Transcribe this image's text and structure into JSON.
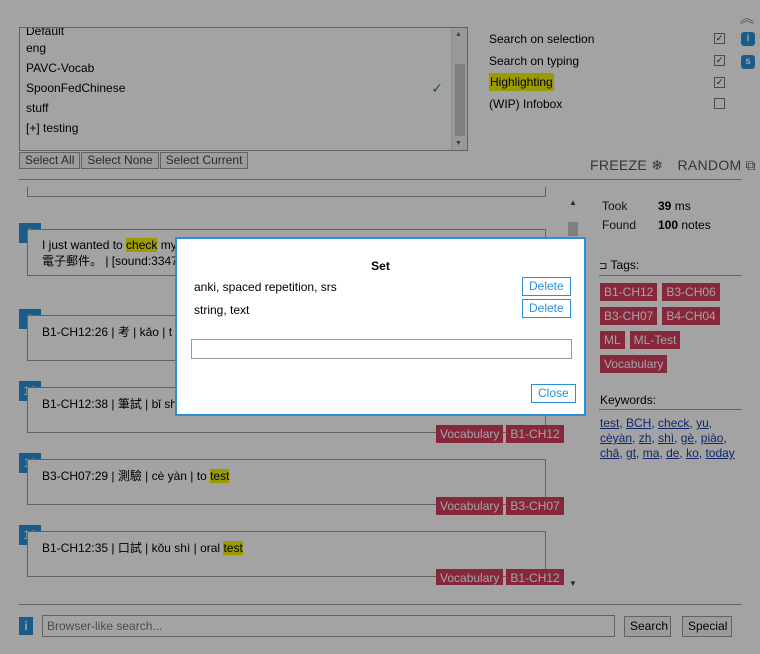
{
  "decks": {
    "items": [
      {
        "label": "Default",
        "checked": false
      },
      {
        "label": "eng",
        "checked": false
      },
      {
        "label": "PAVC-Vocab",
        "checked": false
      },
      {
        "label": "SpoonFedChinese",
        "checked": true
      },
      {
        "label": "stuff",
        "checked": false
      },
      {
        "label": "[+] testing",
        "checked": false
      }
    ],
    "check_mark": "✓",
    "buttons": [
      "Select All",
      "Select None",
      "Select Current"
    ]
  },
  "options": [
    {
      "label": "Search on selection",
      "checked": true,
      "highlighted": false
    },
    {
      "label": "Search on typing",
      "checked": true,
      "highlighted": false
    },
    {
      "label": "Highlighting",
      "checked": true,
      "highlighted": true
    },
    {
      "label": "(WIP) Infobox",
      "checked": false,
      "highlighted": false
    }
  ],
  "side_buttons": [
    "i",
    "s"
  ],
  "controls": {
    "freeze": "FREEZE ❄",
    "random": "RANDOM ⧉"
  },
  "results": [
    {
      "num": "8",
      "text_before": "I just wanted to ",
      "highlight": "check",
      "text_after": " my",
      "line2": "電子郵件。 | [sound:3347",
      "tags": []
    },
    {
      "num": "9",
      "text_before": "B1-CH12:26 | 考 | kǎo | t",
      "highlight": "",
      "text_after": "",
      "line2": "",
      "tags": []
    },
    {
      "num": "10",
      "text_before": "B1-CH12:38 | 筆試 | bǐ sh",
      "highlight": "",
      "text_after": "",
      "line2": "",
      "tags": [
        "Vocabulary",
        "B1-CH12"
      ]
    },
    {
      "num": "11",
      "text_before": "B3-CH07:29 | 測驗 | cè yàn | to ",
      "highlight": "test",
      "text_after": "",
      "line2": "",
      "tags": [
        "Vocabulary",
        "B3-CH07"
      ]
    },
    {
      "num": "12",
      "text_before": "B1-CH12:35 | 口試 | kǒu shì | oral ",
      "highlight": "test",
      "text_after": "",
      "line2": "",
      "tags": [
        "Vocabulary",
        "B1-CH12"
      ]
    }
  ],
  "stats": {
    "took_label": "Took",
    "took_value": "39",
    "took_unit": "ms",
    "found_label": "Found",
    "found_value": "100",
    "found_unit": "notes"
  },
  "tags_panel": {
    "title": "Tags:",
    "icon": "tag-icon",
    "tags": [
      "B1-CH12",
      "B3-CH06",
      "B3-CH07",
      "B4-CH04",
      "ML",
      "ML-Test",
      "Vocabulary"
    ]
  },
  "keywords_panel": {
    "title": "Keywords:",
    "keywords": [
      "test",
      "BCH",
      "check",
      "yu",
      "cèyàn",
      "zh",
      "shì",
      "gè",
      "piào",
      "chā",
      "gt",
      "ma",
      "de",
      "ko",
      "today"
    ]
  },
  "bottom": {
    "info": "i",
    "search_placeholder": "Browser-like search...",
    "search_value": "",
    "search_button": "Search",
    "special_button": "Special"
  },
  "modal": {
    "title": "Set",
    "rows": [
      "anki, spaced repetition, srs",
      "string, text"
    ],
    "delete_label": "Delete",
    "input_value": "",
    "close_label": "Close"
  },
  "colors": {
    "accent": "#2b8fd8",
    "tag": "#d43d5d",
    "highlight": "#f2f200",
    "overlay": "rgba(0,0,0,0.36)"
  }
}
